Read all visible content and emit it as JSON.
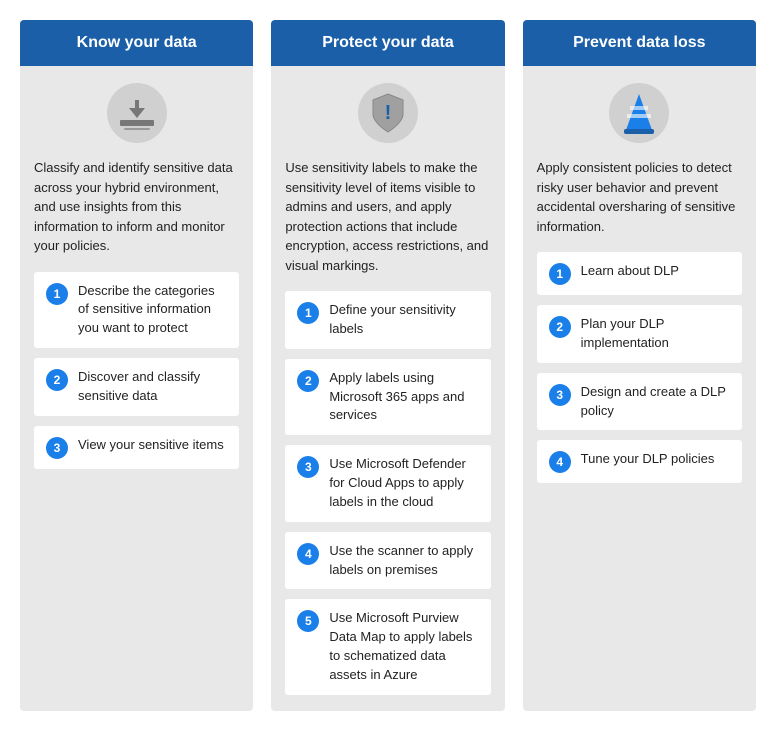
{
  "columns": [
    {
      "id": "know-your-data",
      "header": "Know your data",
      "icon": "database",
      "intro": "Classify and identify sensitive data across your hybrid environment, and use insights from this information to inform and monitor your policies.",
      "steps": [
        {
          "number": "1",
          "text": "Describe the categories of sensitive information you want to protect"
        },
        {
          "number": "2",
          "text": "Discover and classify sensitive data"
        },
        {
          "number": "3",
          "text": "View your sensitive items"
        }
      ]
    },
    {
      "id": "protect-your-data",
      "header": "Protect your data",
      "icon": "shield",
      "intro": "Use sensitivity labels to make the sensitivity level of items visible to admins and users, and apply protection actions that include encryption, access restrictions, and visual markings.",
      "steps": [
        {
          "number": "1",
          "text": "Define your sensitivity labels"
        },
        {
          "number": "2",
          "text": "Apply labels using Microsoft 365 apps and services"
        },
        {
          "number": "3",
          "text": "Use Microsoft Defender for Cloud Apps to apply labels in the cloud"
        },
        {
          "number": "4",
          "text": "Use the scanner to apply labels on premises"
        },
        {
          "number": "5",
          "text": "Use Microsoft Purview Data Map to apply labels to schematized data assets in Azure"
        }
      ]
    },
    {
      "id": "prevent-data-loss",
      "header": "Prevent data loss",
      "icon": "cone",
      "intro": "Apply consistent policies to detect risky user behavior and prevent accidental oversharing of sensitive information.",
      "steps": [
        {
          "number": "1",
          "text": "Learn about DLP"
        },
        {
          "number": "2",
          "text": "Plan your DLP implementation"
        },
        {
          "number": "3",
          "text": "Design and create a DLP policy"
        },
        {
          "number": "4",
          "text": "Tune your DLP policies"
        }
      ]
    }
  ]
}
